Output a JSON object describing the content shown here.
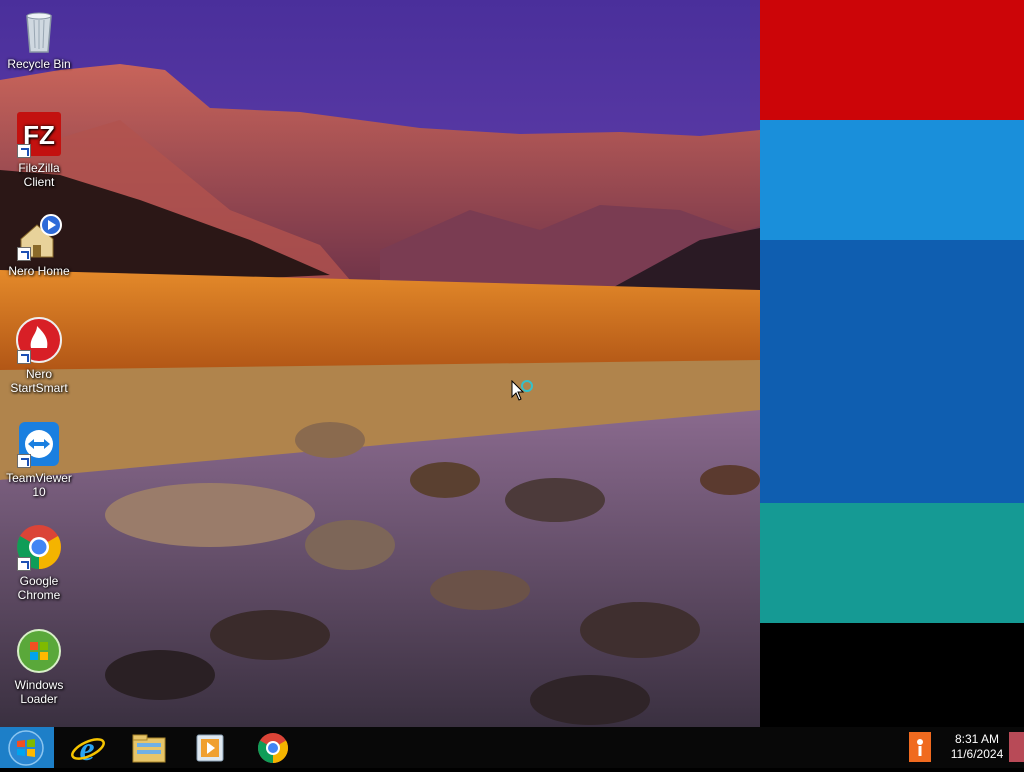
{
  "desktop": {
    "icons": [
      {
        "label": "Recycle Bin",
        "icon": "recycle-bin-icon"
      },
      {
        "label": "FileZilla Client",
        "icon": "filezilla-icon"
      },
      {
        "label": "Nero Home",
        "icon": "nero-home-icon"
      },
      {
        "label": "Nero StartSmart",
        "icon": "nero-startsmart-icon"
      },
      {
        "label": "TeamViewer 10",
        "icon": "teamviewer-icon"
      },
      {
        "label": "Google Chrome",
        "icon": "chrome-icon"
      },
      {
        "label": "Windows Loader",
        "icon": "windows-loader-icon"
      }
    ]
  },
  "tiles": [
    {
      "color": "#cc0508"
    },
    {
      "color": "#1a8fda"
    },
    {
      "color": "#0f5eb0"
    },
    {
      "color": "#159a94"
    },
    {
      "color": "#000000"
    }
  ],
  "taskbar": {
    "start": {
      "icon": "windows-start-icon"
    },
    "pinned": [
      {
        "icon": "internet-explorer-icon"
      },
      {
        "icon": "file-explorer-icon"
      },
      {
        "icon": "media-player-icon"
      },
      {
        "icon": "chrome-icon"
      }
    ],
    "clock": {
      "time": "8:31 AM",
      "date": "11/6/2024"
    }
  }
}
